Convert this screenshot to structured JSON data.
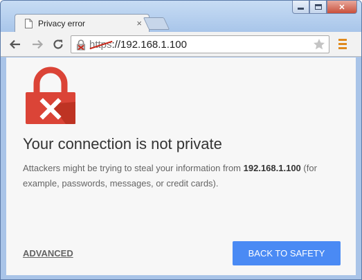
{
  "window": {
    "controls": {
      "close_glyph": "✕"
    }
  },
  "tab": {
    "title": "Privacy error",
    "icon": "page-icon",
    "close_glyph": "×"
  },
  "toolbar": {
    "back_icon": "back-arrow-icon",
    "forward_icon": "forward-arrow-icon",
    "reload_icon": "reload-icon",
    "url_scheme": "https",
    "url_rest": "://192.168.1.100",
    "security_icon": "broken-lock-icon",
    "bookmark_icon": "star-icon",
    "menu_icon": "hamburger-menu-icon"
  },
  "page": {
    "icon": "lock-error-icon",
    "headline": "Your connection is not private",
    "body_prefix": "Attackers might be trying to steal your information from ",
    "body_host": "192.168.1.100",
    "body_suffix": " (for example, passwords, messages, or credit cards).",
    "advanced_label": "ADVANCED",
    "safety_label": "BACK TO SAFETY"
  },
  "colors": {
    "accent": "#4a8af4",
    "error_red": "#db4437",
    "menu_orange": "#e08a1e"
  }
}
